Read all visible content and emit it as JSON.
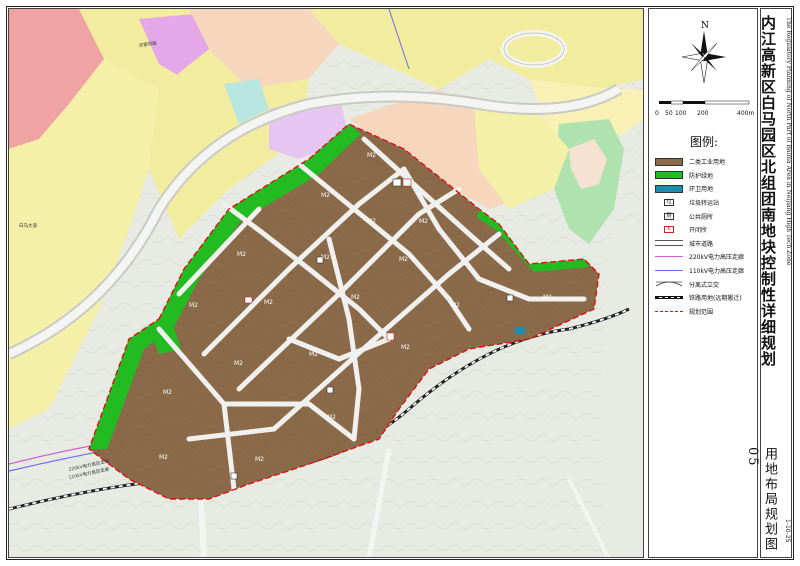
{
  "title": {
    "main": "内江高新区白马园区北组团南地块控制性详细规划",
    "subtitle_en": "The Regulatory Planning of North Part of Baima Area in Neijiang High Tech Zone",
    "drawing_name": "用地布局规划图",
    "drawing_number": "05",
    "drawing_code": "1-10-25"
  },
  "compass": {
    "north_label": "N"
  },
  "scale_bar": {
    "labels": [
      "0",
      "50",
      "100",
      "200",
      "400m"
    ]
  },
  "legend": {
    "title": "图例:",
    "items": [
      {
        "label": "二类工业用地",
        "kind": "fill",
        "color": "#8b6a4a"
      },
      {
        "label": "防护绿地",
        "kind": "fill",
        "color": "#22bb22"
      },
      {
        "label": "环卫用地",
        "kind": "fill",
        "color": "#1a8fb0"
      },
      {
        "label": "垃圾转运站",
        "kind": "symbol",
        "symbol": "垃"
      },
      {
        "label": "公共厕所",
        "kind": "symbol",
        "symbol": "厕"
      },
      {
        "label": "开闭所",
        "kind": "symbol-red",
        "symbol": "K"
      },
      {
        "label": "城市道路",
        "kind": "road"
      },
      {
        "label": "220kV电力高压走廊",
        "kind": "line",
        "color": "#d060d0"
      },
      {
        "label": "110kV电力高压走廊",
        "kind": "line",
        "color": "#6a6af0"
      },
      {
        "label": "分离式立交",
        "kind": "interchange"
      },
      {
        "label": "铁路用地(远期搬迁)",
        "kind": "rail"
      },
      {
        "label": "规划范围",
        "kind": "boundary",
        "color": "#dd1111"
      }
    ]
  },
  "map": {
    "parcel_code": "M2",
    "road_labels": [
      "邓家坝路",
      "白马大道",
      "220kV电力高压走廊",
      "110kV电力高压走廊"
    ]
  }
}
